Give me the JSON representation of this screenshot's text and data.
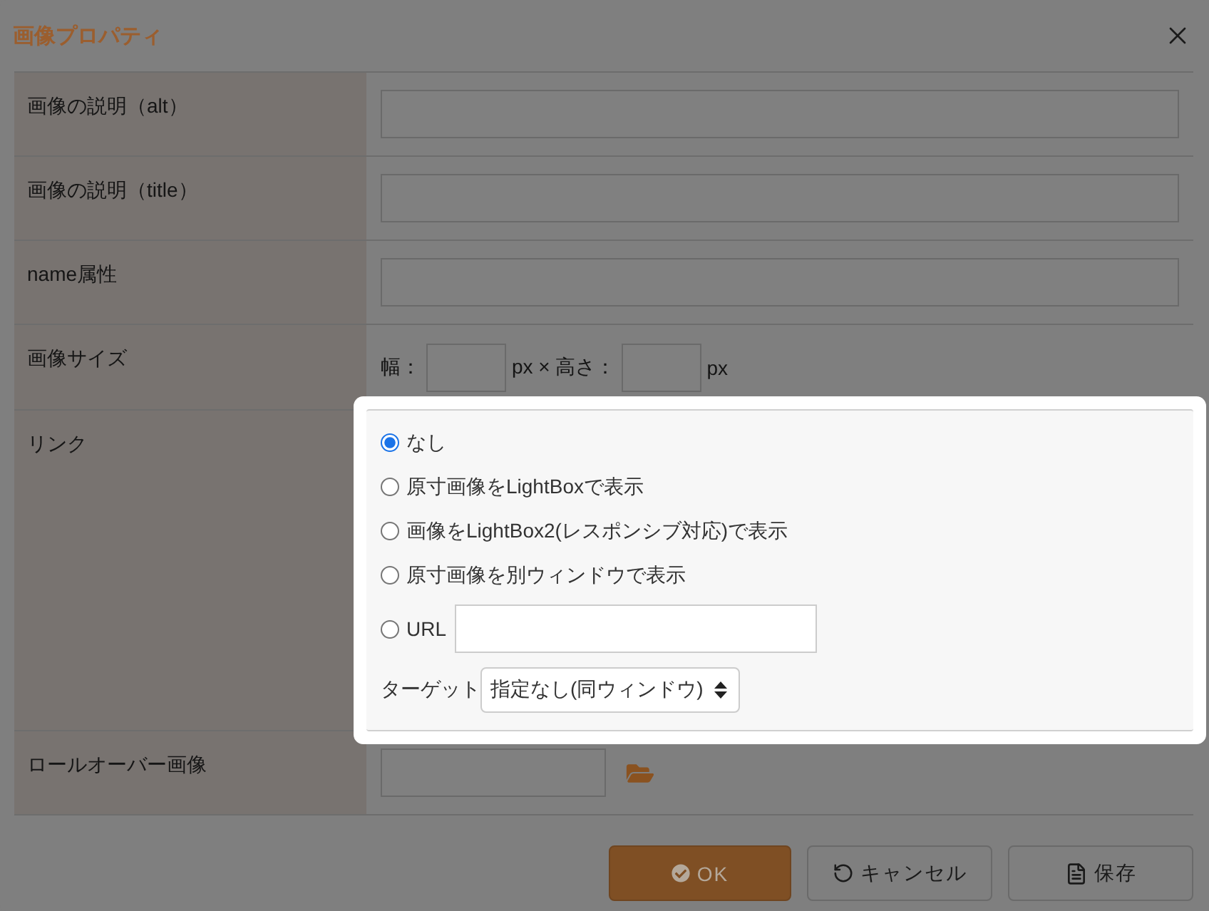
{
  "dialog": {
    "title": "画像プロパティ"
  },
  "rows": [
    {
      "kind": "text",
      "label": "画像の説明（alt）",
      "highlighted": false
    },
    {
      "kind": "text",
      "label": "画像の説明（title）",
      "highlighted": false
    },
    {
      "kind": "text",
      "label": "name属性",
      "highlighted": false
    },
    {
      "kind": "size",
      "label": "画像サイズ",
      "highlighted": false,
      "width_label": "幅：",
      "unit1": "px × 高さ：",
      "unit2": "px"
    },
    {
      "kind": "link",
      "label": "リンク",
      "highlighted": true,
      "options": [
        {
          "label": "なし",
          "selected": true
        },
        {
          "label": "原寸画像をLightBoxで表示",
          "selected": false
        },
        {
          "label": "画像をLightBox2(レスポンシブ対応)で表示",
          "selected": false
        },
        {
          "label": "原寸画像を別ウィンドウで表示",
          "selected": false
        }
      ],
      "url": {
        "label": "URL",
        "selected": false
      },
      "target": {
        "label": "ターゲット",
        "value": "指定なし(同ウィンドウ)"
      }
    },
    {
      "kind": "file",
      "label": "ロールオーバー画像",
      "highlighted": false
    }
  ],
  "buttons": [
    {
      "kind": "ok",
      "label": "OK"
    },
    {
      "kind": "cancel",
      "label": "キャンセル"
    },
    {
      "kind": "save",
      "label": "保存"
    }
  ]
}
